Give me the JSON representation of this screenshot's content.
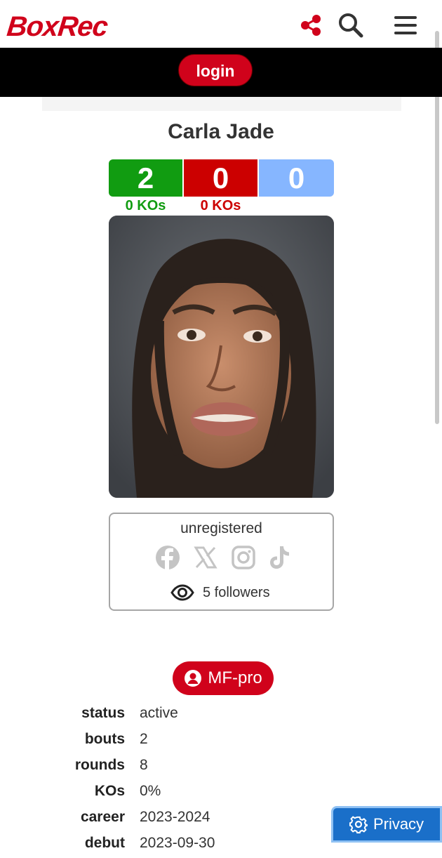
{
  "header": {
    "logo_text": "BoxRec",
    "share_icon": "share-icon",
    "search_icon": "search-icon",
    "menu_icon": "hamburger-menu-icon"
  },
  "login": {
    "label": "login"
  },
  "boxer": {
    "name": "Carla Jade",
    "record": {
      "wins": "2",
      "losses": "0",
      "draws": "0"
    },
    "win_kos": "0 KOs",
    "loss_kos": "0 KOs"
  },
  "profile_card": {
    "status": "unregistered",
    "socials": [
      "facebook-icon",
      "x-icon",
      "instagram-icon",
      "tiktok-icon"
    ],
    "followers": "5 followers"
  },
  "role": {
    "label": "MF-pro"
  },
  "stats": [
    {
      "label": "status",
      "value": "active"
    },
    {
      "label": "bouts",
      "value": "2"
    },
    {
      "label": "rounds",
      "value": "8"
    },
    {
      "label": "KOs",
      "value": "0%"
    },
    {
      "label": "career",
      "value": "2023-2024"
    },
    {
      "label": "debut",
      "value": "2023-09-30"
    }
  ],
  "privacy": {
    "label": "Privacy"
  },
  "colors": {
    "brand_red": "#d0021b",
    "win_green": "#119c11",
    "loss_red": "#cc0000",
    "draw_blue": "#86b6ff",
    "privacy_blue": "#1a6fc9"
  }
}
